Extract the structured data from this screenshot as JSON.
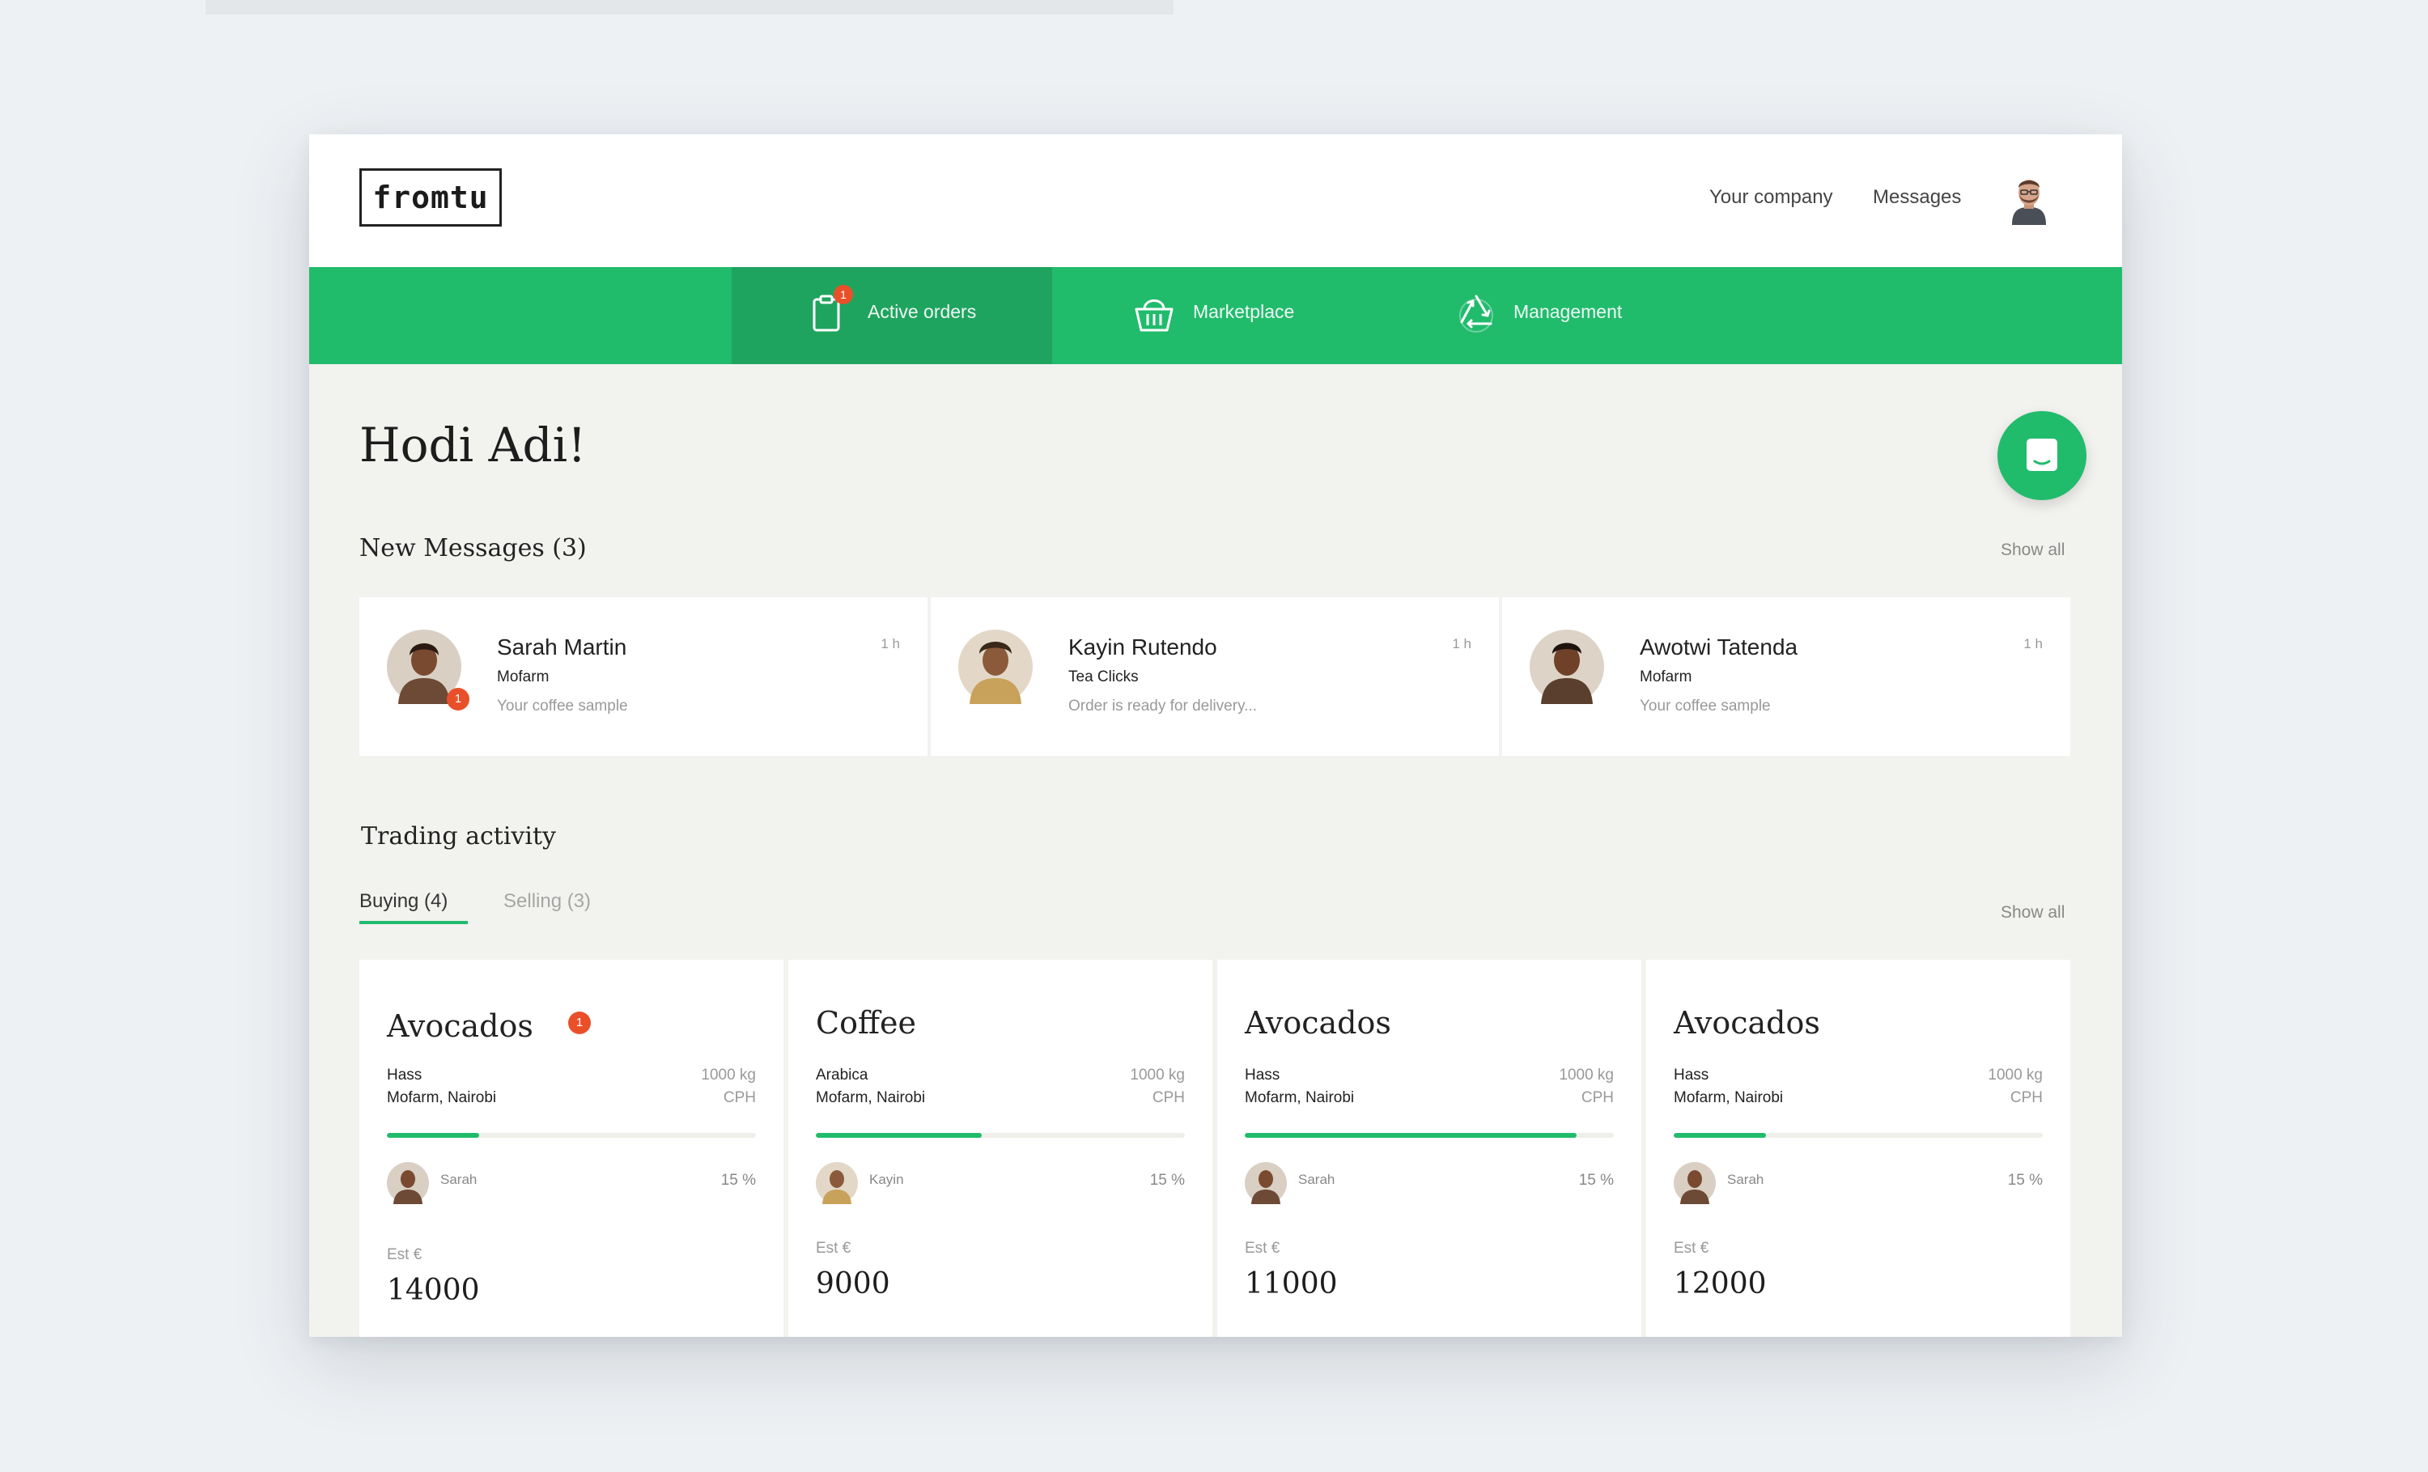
{
  "colors": {
    "brand_green": "#21bb6c",
    "badge_orange": "#e9502a"
  },
  "header": {
    "logo": "fromtu",
    "links": [
      "Your company",
      "Messages"
    ]
  },
  "nav": {
    "tabs": [
      {
        "label": "Active orders",
        "icon": "clipboard-icon",
        "badge": "1"
      },
      {
        "label": "Marketplace",
        "icon": "basket-icon"
      },
      {
        "label": "Management",
        "icon": "recycle-icon"
      }
    ]
  },
  "greeting": "Hodi Adi!",
  "messages": {
    "title": "New Messages (3)",
    "show_all": "Show all",
    "items": [
      {
        "name": "Sarah Martin",
        "company": "Mofarm",
        "text": "Your coffee sample",
        "time": "1 h",
        "badge": "1"
      },
      {
        "name": "Kayin Rutendo",
        "company": "Tea Clicks",
        "text": "Order is ready for delivery...",
        "time": "1 h"
      },
      {
        "name": "Awotwi Tatenda",
        "company": "Mofarm",
        "text": "Your coffee sample",
        "time": "1 h"
      }
    ]
  },
  "trading": {
    "title": "Trading activity",
    "tabs": [
      "Buying (4)",
      "Selling (3)"
    ],
    "show_all": "Show all",
    "cards": [
      {
        "product": "Avocados",
        "badge": "1",
        "variety": "Hass",
        "location": "Mofarm, Nairobi",
        "quantity": "1000 kg",
        "city": "CPH",
        "progress": 0.25,
        "user": "Sarah",
        "percent": "15 %",
        "est_label": "Est €",
        "amount": "14000"
      },
      {
        "product": "Coffee",
        "variety": "Arabica",
        "location": "Mofarm, Nairobi",
        "quantity": "1000 kg",
        "city": "CPH",
        "progress": 0.45,
        "user": "Kayin",
        "percent": "15 %",
        "est_label": "Est €",
        "amount": "9000"
      },
      {
        "product": "Avocados",
        "variety": "Hass",
        "location": "Mofarm, Nairobi",
        "quantity": "1000 kg",
        "city": "CPH",
        "progress": 0.9,
        "user": "Sarah",
        "percent": "15 %",
        "est_label": "Est €",
        "amount": "11000"
      },
      {
        "product": "Avocados",
        "variety": "Hass",
        "location": "Mofarm, Nairobi",
        "quantity": "1000 kg",
        "city": "CPH",
        "progress": 0.25,
        "user": "Sarah",
        "percent": "15 %",
        "est_label": "Est €",
        "amount": "12000"
      }
    ]
  }
}
